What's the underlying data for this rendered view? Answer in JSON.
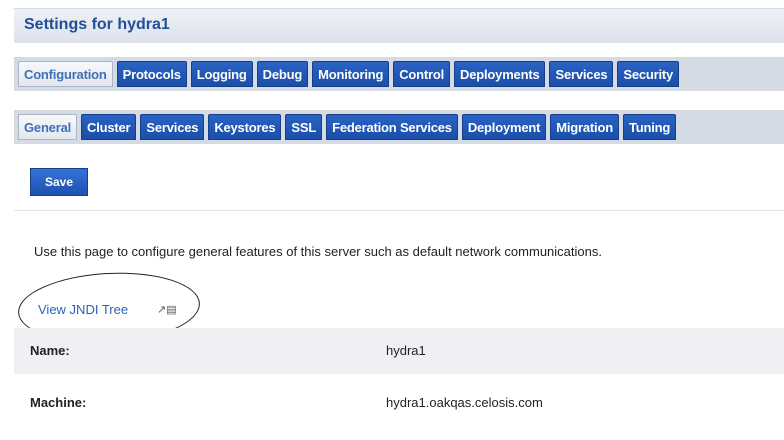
{
  "header": {
    "title": "Settings for hydra1"
  },
  "main_tabs": [
    {
      "label": "Configuration",
      "active": true
    },
    {
      "label": "Protocols",
      "active": false
    },
    {
      "label": "Logging",
      "active": false
    },
    {
      "label": "Debug",
      "active": false
    },
    {
      "label": "Monitoring",
      "active": false
    },
    {
      "label": "Control",
      "active": false
    },
    {
      "label": "Deployments",
      "active": false
    },
    {
      "label": "Services",
      "active": false
    },
    {
      "label": "Security",
      "active": false
    }
  ],
  "sub_tabs": [
    {
      "label": "General",
      "active": true
    },
    {
      "label": "Cluster",
      "active": false
    },
    {
      "label": "Services",
      "active": false
    },
    {
      "label": "Keystores",
      "active": false
    },
    {
      "label": "SSL",
      "active": false
    },
    {
      "label": "Federation Services",
      "active": false
    },
    {
      "label": "Deployment",
      "active": false
    },
    {
      "label": "Migration",
      "active": false
    },
    {
      "label": "Tuning",
      "active": false
    }
  ],
  "toolbar": {
    "save_label": "Save"
  },
  "description": "Use this page to configure general features of this server such as default network communications.",
  "jndi_link": {
    "label": "View JNDI Tree",
    "icon": "external-link-icon"
  },
  "fields": [
    {
      "label": "Name:",
      "value": "hydra1"
    },
    {
      "label": "Machine:",
      "value": "hydra1.oakqas.celosis.com"
    }
  ],
  "side_tag": "",
  "colors": {
    "tab_blue": "#1f55b5",
    "title_blue": "#1f4e9a",
    "link_blue": "#2c62b8"
  }
}
